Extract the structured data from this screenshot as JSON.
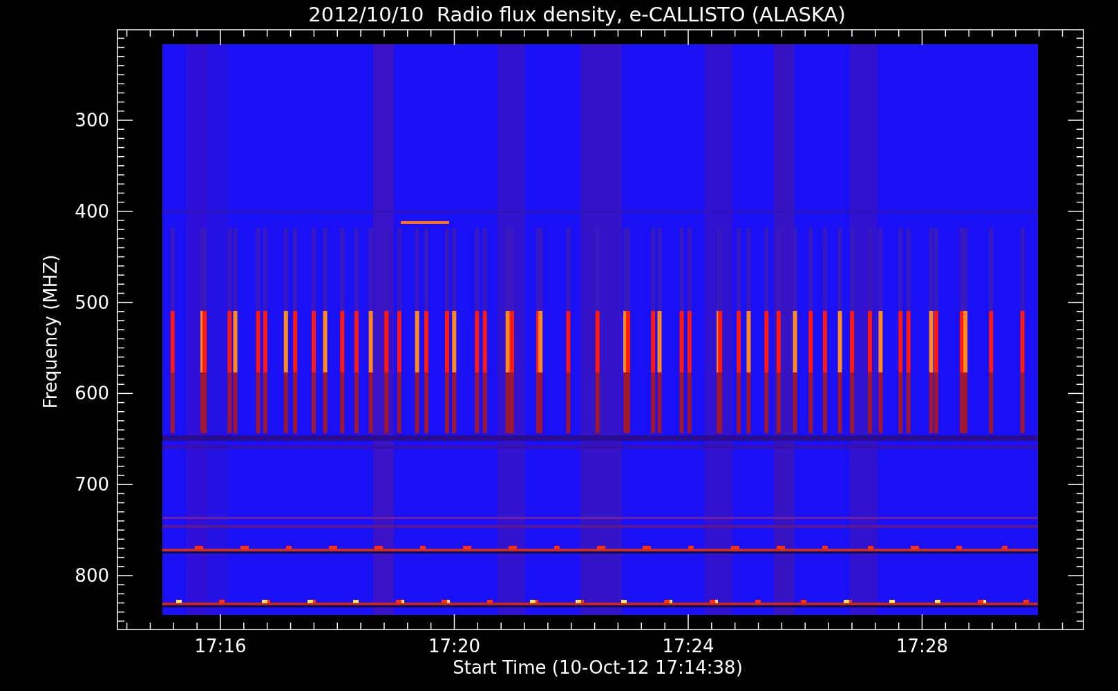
{
  "title": "2012/10/10  Radio flux density, e-CALLISTO (ALASKA)",
  "y_axis": {
    "label": "Frequency (MHZ)",
    "ticks": [
      "300",
      "400",
      "500",
      "600",
      "700",
      "800"
    ]
  },
  "x_axis": {
    "label": "Start Time (10-Oct-12 17:14:38)",
    "ticks": [
      "17:16",
      "17:20",
      "17:24",
      "17:28"
    ]
  }
}
